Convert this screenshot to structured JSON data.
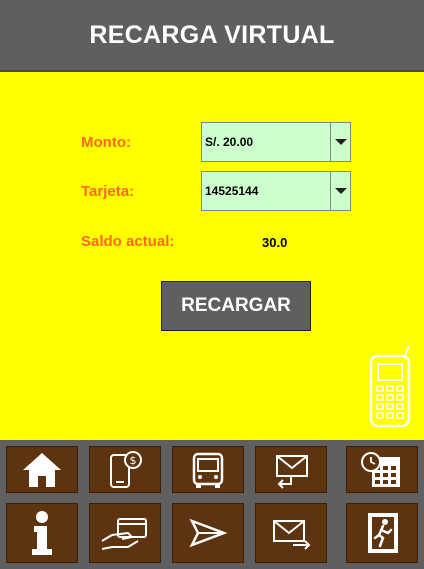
{
  "header": {
    "title": "RECARGA VIRTUAL"
  },
  "form": {
    "amount_label": "Monto:",
    "amount_value": "S/. 20.00",
    "card_label": "Tarjeta:",
    "card_value": "14525144",
    "balance_label": "Saldo actual:",
    "balance_value": "30.0"
  },
  "actions": {
    "recharge_label": "RECARGAR"
  },
  "colors": {
    "header_bg": "#5f5f5f",
    "main_bg": "#ffff00",
    "label": "#ff6a1a",
    "select_bg": "#ccffcc",
    "nav_button_bg": "#5e3310"
  },
  "nav": {
    "row1": [
      "home-icon",
      "mobile-payment-icon",
      "bus-icon",
      "message-reply-icon",
      "calendar-schedule-icon"
    ],
    "row2": [
      "info-icon",
      "card-payment-icon",
      "send-icon",
      "mail-forward-icon",
      "exit-icon"
    ]
  }
}
